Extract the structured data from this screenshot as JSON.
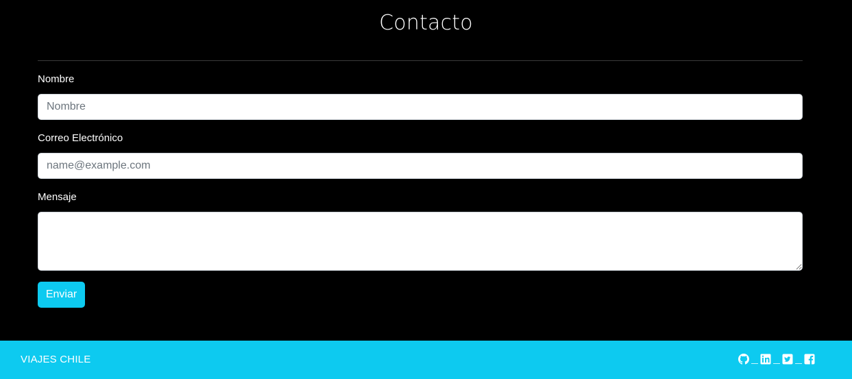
{
  "page": {
    "title": "Contacto"
  },
  "form": {
    "name": {
      "label": "Nombre",
      "placeholder": "Nombre",
      "value": ""
    },
    "email": {
      "label": "Correo Electrónico",
      "placeholder": "name@example.com",
      "value": ""
    },
    "message": {
      "label": "Mensaje",
      "placeholder": "",
      "value": ""
    },
    "submit_label": "Enviar"
  },
  "footer": {
    "brand": "VIAJES CHILE",
    "social_icons": [
      "github-icon",
      "linkedin-icon",
      "twitter-icon",
      "facebook-icon"
    ]
  },
  "colors": {
    "background": "#000000",
    "accent": "#0dcaf0",
    "text": "#ffffff"
  }
}
